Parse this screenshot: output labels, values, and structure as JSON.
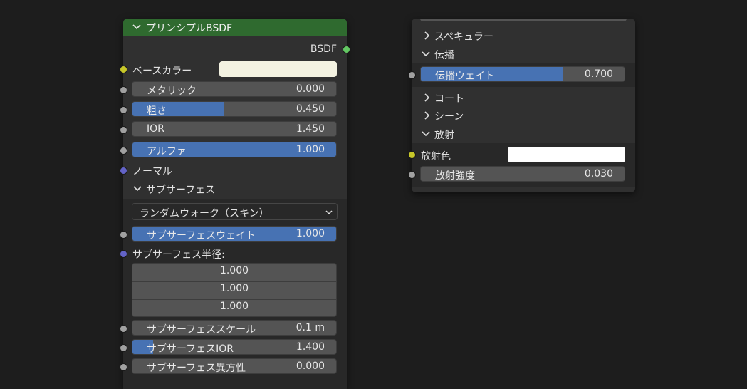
{
  "bsdf_node": {
    "title": "プリンシプルBSDF",
    "output_label": "BSDF",
    "base_color": {
      "label": "ベースカラー",
      "color": "#f3f2e1"
    },
    "metallic": {
      "label": "メタリック",
      "value": "0.000",
      "fraction": 0.0
    },
    "roughness": {
      "label": "粗さ",
      "value": "0.450",
      "fraction": 0.45
    },
    "ior": {
      "label": "IOR",
      "value": "1.450",
      "fraction": 0.0
    },
    "alpha": {
      "label": "アルファ",
      "value": "1.000",
      "fraction": 1.0
    },
    "normal": {
      "label": "ノーマル"
    },
    "subsurface_panel": {
      "label": "サブサーフェス"
    },
    "subsurface_method": {
      "value": "ランダムウォーク（スキン）"
    },
    "subsurface_weight": {
      "label": "サブサーフェスウェイト",
      "value": "1.000",
      "fraction": 1.0
    },
    "subsurface_radius": {
      "label": "サブサーフェス半径:",
      "values": [
        "1.000",
        "1.000",
        "1.000"
      ]
    },
    "subsurface_scale": {
      "label": "サブサーフェススケール",
      "value": "0.1 m",
      "fraction": 0.0
    },
    "subsurface_ior": {
      "label": "サブサーフェスIOR",
      "value": "1.400",
      "fraction": 0.1
    },
    "subsurface_anisotropy": {
      "label": "サブサーフェス異方性",
      "value": "0.000",
      "fraction": 0.0
    }
  },
  "right_node": {
    "specular_panel": {
      "label": "スペキュラー"
    },
    "transmission_panel": {
      "label": "伝播"
    },
    "transmission_weight": {
      "label": "伝播ウェイト",
      "value": "0.700",
      "fraction": 0.7
    },
    "coat_panel": {
      "label": "コート"
    },
    "sheen_panel": {
      "label": "シーン"
    },
    "emission_panel": {
      "label": "放射"
    },
    "emission_color": {
      "label": "放射色",
      "color": "#ffffff"
    },
    "emission_strength": {
      "label": "放射強度",
      "value": "0.030",
      "fraction": 0.0
    }
  },
  "colors": {
    "header_green": "#2f6a2f",
    "slider_blue": "#4772b3",
    "field_gray": "#545454",
    "socket_gray": "#a1a1a1",
    "socket_yellow": "#c7c729",
    "socket_blue": "#6363c7",
    "socket_green": "#63c763"
  },
  "icons": [
    "chevron-down-icon",
    "chevron-right-icon",
    "dropdown-arrow-icon"
  ]
}
